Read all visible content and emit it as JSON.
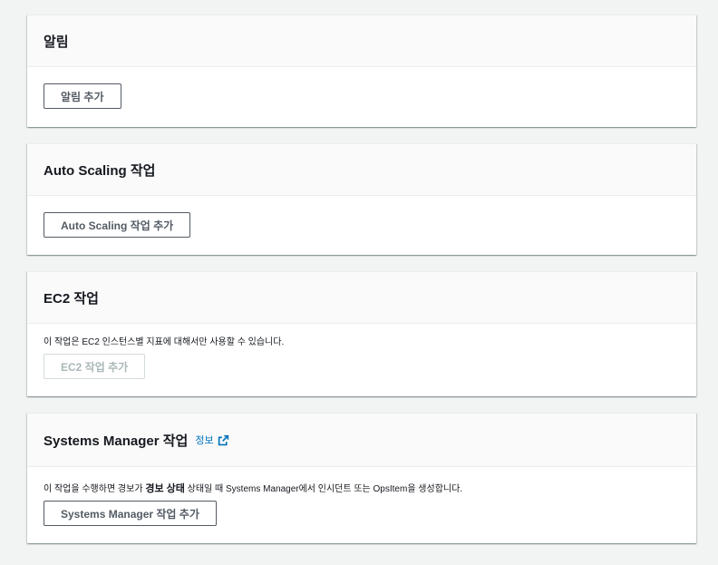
{
  "alarms": {
    "title": "알림",
    "add_button": "알림 추가"
  },
  "autoscaling": {
    "title": "Auto Scaling 작업",
    "add_button": "Auto Scaling 작업 추가"
  },
  "ec2": {
    "title": "EC2 작업",
    "description": "이 작업은 EC2 인스턴스별 지표에 대해서만 사용할 수 있습니다.",
    "add_button": "EC2 작업 추가"
  },
  "ssm": {
    "title": "Systems Manager 작업",
    "info_link": "정보",
    "description_prefix": "이 작업을 수행하면 경보가 ",
    "description_bold": "경보 상태",
    "description_suffix": " 상태일 때 Systems Manager에서 인시던트 또는 OpsItem을 생성합니다.",
    "add_button": "Systems Manager 작업 추가"
  },
  "colors": {
    "background": "#f2f3f3",
    "link": "#0073bb",
    "button_border": "#545b64",
    "disabled": "#aab7b8"
  },
  "icons": [
    "external-link-icon"
  ]
}
